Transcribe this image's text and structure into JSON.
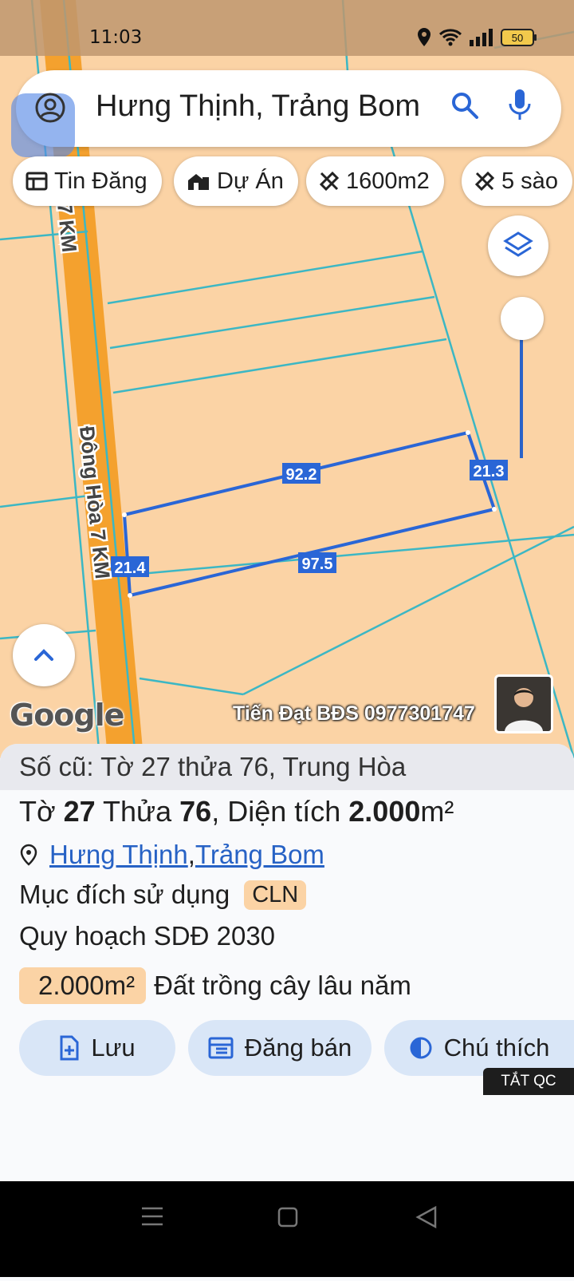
{
  "status_bar": {
    "time": "11:03",
    "battery": "50"
  },
  "search": {
    "query": "Hưng Thịnh, Trảng Bom"
  },
  "chips": [
    {
      "label": "Tin Đăng",
      "icon": "listing-icon"
    },
    {
      "label": "Dự Án",
      "icon": "building-icon"
    },
    {
      "label": "1600m2",
      "icon": "ruler-icon"
    },
    {
      "label": "5 sào",
      "icon": "ruler-icon"
    }
  ],
  "map": {
    "road_label_top": "7 KM",
    "road_label": "Đông Hòa 7 KM",
    "edges": {
      "top": "92.2",
      "right": "21.3",
      "bottom": "97.5",
      "left": "21.4"
    },
    "logo": "Google",
    "watermark": "Tiến Đạt BĐS 0977301747",
    "colors": {
      "land": "#fbd3a5",
      "road": "#f4a12e",
      "parcel_line": "#2a66d6",
      "boundary": "#3cb7c4"
    }
  },
  "details": {
    "old_info": "Số cũ: Tờ 27 thửa 76, Trung Hòa",
    "to_label": "Tờ ",
    "to_value": "27",
    "thua_label": " Thửa ",
    "thua_value": "76",
    "area_label": ", Diện tích ",
    "area_value": "2.000",
    "area_unit": "m²",
    "ward": "Hưng Thịnh",
    "separator": ", ",
    "district": "Trảng Bom",
    "purpose_label": "Mục đích sử dụng",
    "purpose_code": "CLN",
    "plan_label": "Quy hoạch SDĐ 2030",
    "zone_area": "2.000m²",
    "zone_desc": "Đất trồng cây lâu năm"
  },
  "actions": {
    "save": "Lưu",
    "post_sale": "Đăng bán",
    "legend": "Chú thích"
  },
  "ads_off": "TẮT QC"
}
